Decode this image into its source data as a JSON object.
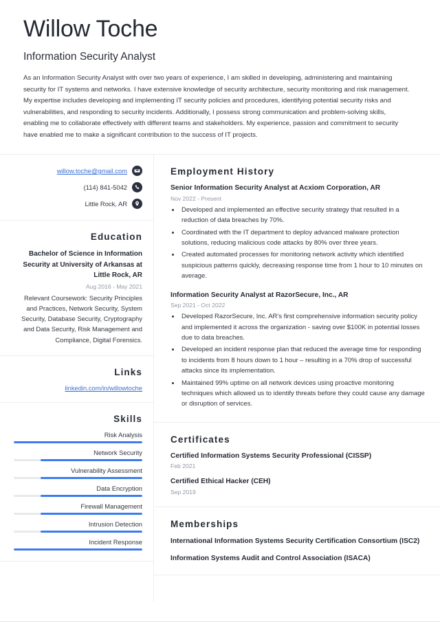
{
  "colors": {
    "accent": "#3b7bef",
    "link": "#3b6fd4",
    "heading": "#262a34",
    "muted": "#9298a5",
    "track": "#e7e9eb"
  },
  "header": {
    "name": "Willow Toche",
    "job_title": "Information Security Analyst",
    "summary": "As an Information Security Analyst with over two years of experience, I am skilled in developing, administering and maintaining security for IT systems and networks. I have extensive knowledge of security architecture, security monitoring and risk management. My expertise includes developing and implementing IT security policies and procedures, identifying potential security risks and vulnerabilities, and responding to security incidents. Additionally, I possess strong communication and problem-solving skills, enabling me to collaborate effectively with different teams and stakeholders. My experience, passion and commitment to security have enabled me to make a significant contribution to the success of IT projects."
  },
  "sidebar": {
    "contact": [
      {
        "icon": "envelope-icon",
        "text": "willow.toche@gmail.com",
        "is_link": true
      },
      {
        "icon": "phone-icon",
        "text": "(114) 841-5042",
        "is_link": false
      },
      {
        "icon": "location-pin-icon",
        "text": "Little Rock, AR",
        "is_link": false
      }
    ],
    "education": {
      "heading": "Education",
      "degree": "Bachelor of Science in Information Security at University of Arkansas at Little Rock, AR",
      "date": "Aug 2016 - May 2021",
      "description": "Relevant Coursework: Security Principles and Practices, Network Security, System Security, Database Security, Cryptography and Data Security, Risk Management and Compliance, Digital Forensics."
    },
    "links": {
      "heading": "Links",
      "items": [
        {
          "label": "linkedin.com/in/willowtoche"
        }
      ]
    },
    "skills": {
      "heading": "Skills",
      "items": [
        {
          "label": "Risk Analysis",
          "level": 100
        },
        {
          "label": "Network Security",
          "level": 79
        },
        {
          "label": "Vulnerability Assessment",
          "level": 79
        },
        {
          "label": "Data Encryption",
          "level": 79
        },
        {
          "label": "Firewall Management",
          "level": 79
        },
        {
          "label": "Intrusion Detection",
          "level": 79
        },
        {
          "label": "Incident Response",
          "level": 100
        }
      ]
    }
  },
  "main": {
    "employment": {
      "heading": "Employment History",
      "entries": [
        {
          "title": "Senior Information Security Analyst at Acxiom Corporation, AR",
          "date": "Nov 2022 - Present",
          "bullets": [
            "Developed and implemented an effective security strategy that resulted in a reduction of data breaches by 70%.",
            "Coordinated with the IT department to deploy advanced malware protection solutions, reducing malicious code attacks by 80% over three years.",
            "Created automated processes for monitoring network activity which identified suspicious patterns quickly, decreasing response time from 1 hour to 10 minutes on average."
          ]
        },
        {
          "title": "Information Security Analyst at RazorSecure, Inc., AR",
          "date": "Sep 2021 - Oct 2022",
          "bullets": [
            "Developed RazorSecure, Inc. AR’s first comprehensive information security policy and implemented it across the organization - saving over $100K in potential losses due to data breaches.",
            "Developed an incident response plan that reduced the average time for responding to incidents from 8 hours down to 1 hour – resulting in a 70% drop of successful attacks since its implementation.",
            "Maintained 99% uptime on all network devices using proactive monitoring techniques which allowed us to identify threats before they could cause any damage or disruption of services."
          ]
        }
      ]
    },
    "certificates": {
      "heading": "Certificates",
      "entries": [
        {
          "title": "Certified Information Systems Security Professional (CISSP)",
          "date": "Feb 2021"
        },
        {
          "title": "Certified Ethical Hacker (CEH)",
          "date": "Sep 2019"
        }
      ]
    },
    "memberships": {
      "heading": "Memberships",
      "entries": [
        {
          "title": "International Information Systems Security Certification Consortium (ISC2)"
        },
        {
          "title": "Information Systems Audit and Control Association (ISACA)"
        }
      ]
    }
  }
}
